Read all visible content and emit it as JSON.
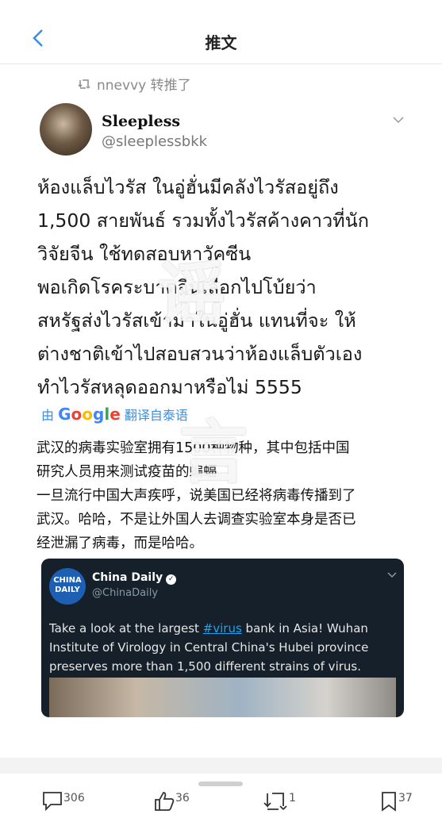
{
  "header": {
    "title": "推文",
    "back_icon": "chevron-left-icon"
  },
  "retweet_note": {
    "icon": "retweet-icon",
    "text": "nnevvy 转推了"
  },
  "author": {
    "name": "Sleepless",
    "handle": "@sleeplessbkk"
  },
  "tweet": {
    "text_lines": [
      "ห้องแล็บไวรัส ในอู่ฮั่นมีคลังไวรัสอยู่ถึง",
      "1,500 สายพันธ์ รวมทั้งไวรัสค้างคาวที่นัก",
      "วิจัยจีน ใช้ทดสอบหาวัคซีน",
      "พอเกิดโรคระบาดจีนเลือกไปโบ้ยว่า",
      "สหรัฐส่งไวรัสเข้ามาในอู่ฮั่น แทนที่จะ ให้",
      "ต่างชาติเข้าไปสอบสวนว่าห้องแล็บตัวเอง",
      "ทำไวรัสหลุดออกมาหรือไม่ 5555"
    ]
  },
  "translate": {
    "prefix": "由",
    "brand": "Google",
    "suffix": "翻译自泰语"
  },
  "translation_lines": [
    "武汉的病毒实验室拥有1500种物种，其中包括中国",
    "研究人员用来测试疫苗的蝙蝠",
    "一旦流行中国大声疾呼，说美国已经将病毒传播到了",
    "武汉。哈哈，不是让外国人去调查实验室本身是否已",
    "经泄漏了病毒，而是哈哈。"
  ],
  "quoted": {
    "logo_text": "CHINA DAILY",
    "name": "China Daily",
    "handle": "@ChinaDaily",
    "text_pre": "Take a look at the largest ",
    "hashtag": "#virus",
    "text_post": " bank in Asia! Wuhan Institute of Virology in Central China's Hubei province preserves more than 1,500 different strains of virus."
  },
  "overlay": {
    "char1": "谣",
    "char2": "言"
  },
  "actions": {
    "reply": {
      "icon": "comment-icon",
      "count": "306"
    },
    "like": {
      "icon": "thumbs-up-icon",
      "count": "36"
    },
    "retweet": {
      "icon": "retweet-icon",
      "count": "1"
    },
    "bookmark": {
      "icon": "bookmark-icon",
      "count": "37"
    }
  },
  "colors": {
    "accent": "#3a8ee6",
    "card_bg": "#15202b"
  }
}
